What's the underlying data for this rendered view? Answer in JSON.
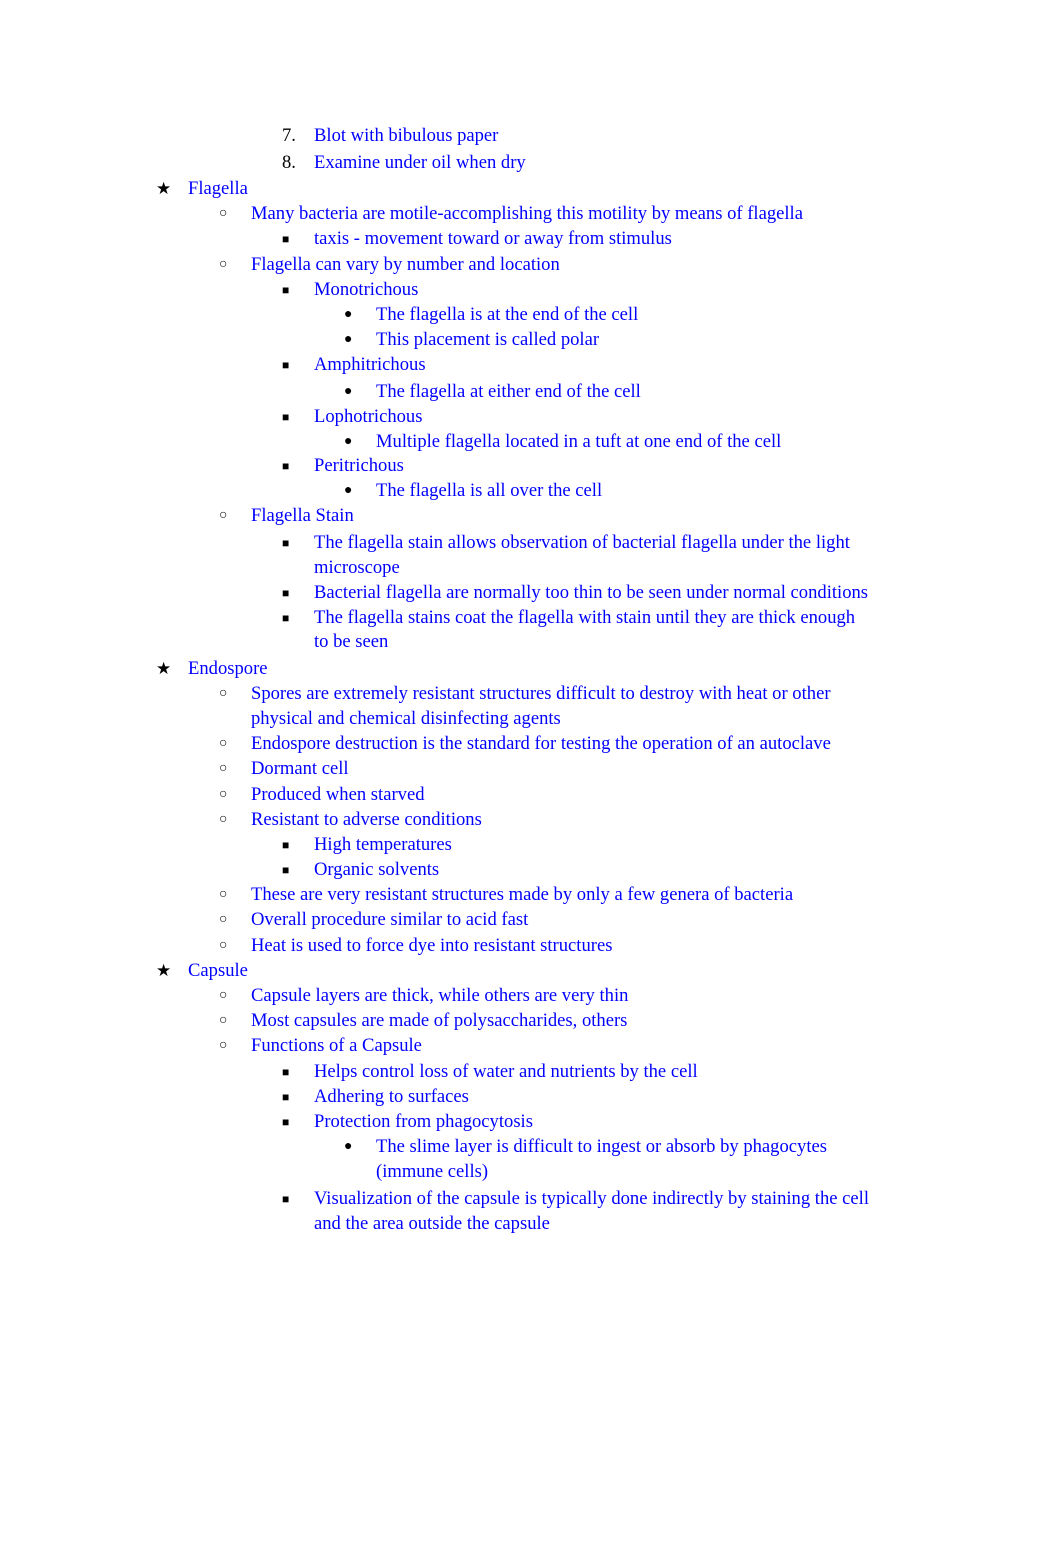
{
  "document": {
    "numbered_steps": [
      {
        "number": "7.",
        "text": "Blot with bibulous paper"
      },
      {
        "number": "8.",
        "text": "Examine under oil when dry"
      }
    ],
    "sections": [
      {
        "title": "Flagella",
        "items": [
          {
            "text": "Many bacteria are motile-accomplishing this motility by means of flagella",
            "children": [
              {
                "text": "taxis - movement toward or away from stimulus"
              }
            ]
          },
          {
            "text": "Flagella can vary by number and location",
            "children": [
              {
                "text": "Monotrichous",
                "children": [
                  {
                    "text": "The flagella is at the end of the cell"
                  },
                  {
                    "text": "This placement is called polar"
                  }
                ]
              },
              {
                "text": "Amphitrichous",
                "children": [
                  {
                    "text": "The flagella at either end of the cell"
                  }
                ]
              },
              {
                "text": "Lophotrichous",
                "children": [
                  {
                    "text": "Multiple flagella located in a tuft at one end of the cell"
                  }
                ]
              },
              {
                "text": "Peritrichous",
                "children": [
                  {
                    "text": "The flagella is all over the cell"
                  }
                ]
              }
            ]
          },
          {
            "text": "Flagella Stain",
            "children": [
              {
                "text_line1": "The flagella stain allows observation of bacterial flagella under the light",
                "text_line2": "microscope"
              },
              {
                "text": "Bacterial flagella are normally too thin to be seen under normal conditions"
              },
              {
                "text_line1": "The flagella stains coat the flagella with stain until they are thick enough",
                "text_line2": "to be seen"
              }
            ]
          }
        ]
      },
      {
        "title": "Endospore",
        "items": [
          {
            "text_line1": "Spores are extremely resistant structures difficult to destroy with heat or other",
            "text_line2": "physical and chemical disinfecting agents"
          },
          {
            "text": "Endospore destruction is the standard for testing the operation of an autoclave"
          },
          {
            "text": "Dormant cell"
          },
          {
            "text": "Produced when starved"
          },
          {
            "text": "Resistant to adverse conditions",
            "children": [
              {
                "text": "High temperatures"
              },
              {
                "text": "Organic solvents"
              }
            ]
          },
          {
            "text": "These are very resistant structures made by only a few genera of bacteria"
          },
          {
            "text": "Overall procedure similar to acid fast"
          },
          {
            "text": "Heat is used to force dye into resistant structures"
          }
        ]
      },
      {
        "title": "Capsule",
        "items": [
          {
            "text": "Capsule layers are thick, while others are very thin"
          },
          {
            "text": "Most capsules are made of polysaccharides, others"
          },
          {
            "text": "Functions of a Capsule",
            "children": [
              {
                "text": "Helps control loss of water and nutrients by the cell"
              },
              {
                "text": "Adhering to surfaces"
              },
              {
                "text": "Protection from phagocytosis",
                "children": [
                  {
                    "text_line1": "The slime layer is difficult to ingest or absorb by phagocytes",
                    "text_line2": "(immune cells)"
                  }
                ]
              },
              {
                "text_line1": "Visualization of the capsule is typically done indirectly by staining the cell",
                "text_line2": "and the area outside the capsule"
              }
            ]
          }
        ]
      }
    ],
    "bullets": {
      "level1": "★",
      "level2": "○",
      "level3": "■",
      "level4": "●"
    },
    "colors": {
      "text": "#0000ff",
      "bullet": "#000000",
      "background": "#ffffff"
    }
  }
}
